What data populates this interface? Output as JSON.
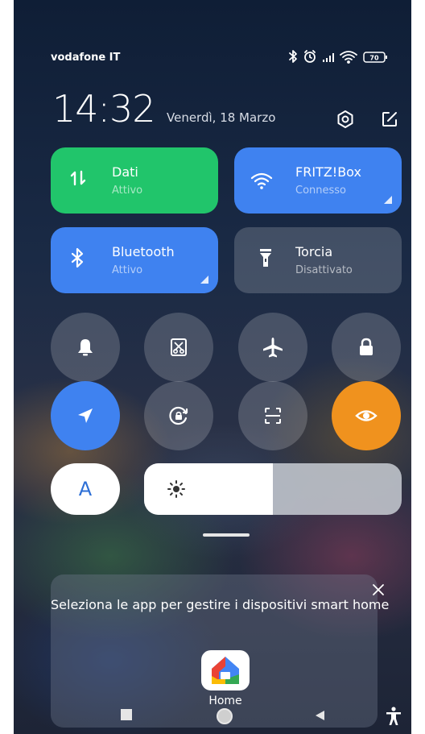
{
  "status_bar": {
    "carrier": "vodafone IT",
    "battery": "70",
    "icons": [
      "bluetooth-icon",
      "alarm-icon",
      "signal-icon",
      "wifi-icon",
      "battery-icon"
    ]
  },
  "header": {
    "time": "14:32",
    "date": "Venerdì, 18 Marzo",
    "icons": [
      "settings-icon",
      "edit-icon"
    ]
  },
  "tiles": [
    {
      "label": "Dati",
      "status": "Attivo",
      "color": "#21c56b",
      "icon": "mobile-data-icon"
    },
    {
      "label": "FRITZ!Box",
      "status": "Connesso",
      "color": "#3f82f0",
      "icon": "wifi-icon"
    },
    {
      "label": "Bluetooth",
      "status": "Attivo",
      "color": "#3f82f0",
      "icon": "bluetooth-icon"
    },
    {
      "label": "Torcia",
      "status": "Disattivato",
      "color": "rgba(255,255,255,0.18)",
      "icon": "flashlight-icon"
    }
  ],
  "toggles_row1": [
    "bell-icon",
    "screenshot-icon",
    "airplane-icon",
    "lock-icon"
  ],
  "toggles_row2": [
    "location-icon",
    "rotation-lock-icon",
    "scanner-icon",
    "eye-icon"
  ],
  "active_colors": {
    "location": "#3f82f0",
    "reading_mode": "#f0921e"
  },
  "font_toggle": {
    "label": "A"
  },
  "brightness": {
    "level": 0.5,
    "icon": "sun-icon"
  },
  "smart_home": {
    "message": "Seleziona le app per gestire i dispositivi smart home",
    "app_label": "Home",
    "close_icon": "close-icon"
  },
  "nav_bar": {
    "icons": [
      "recents-icon",
      "home-icon",
      "back-icon",
      "accessibility-icon"
    ]
  }
}
